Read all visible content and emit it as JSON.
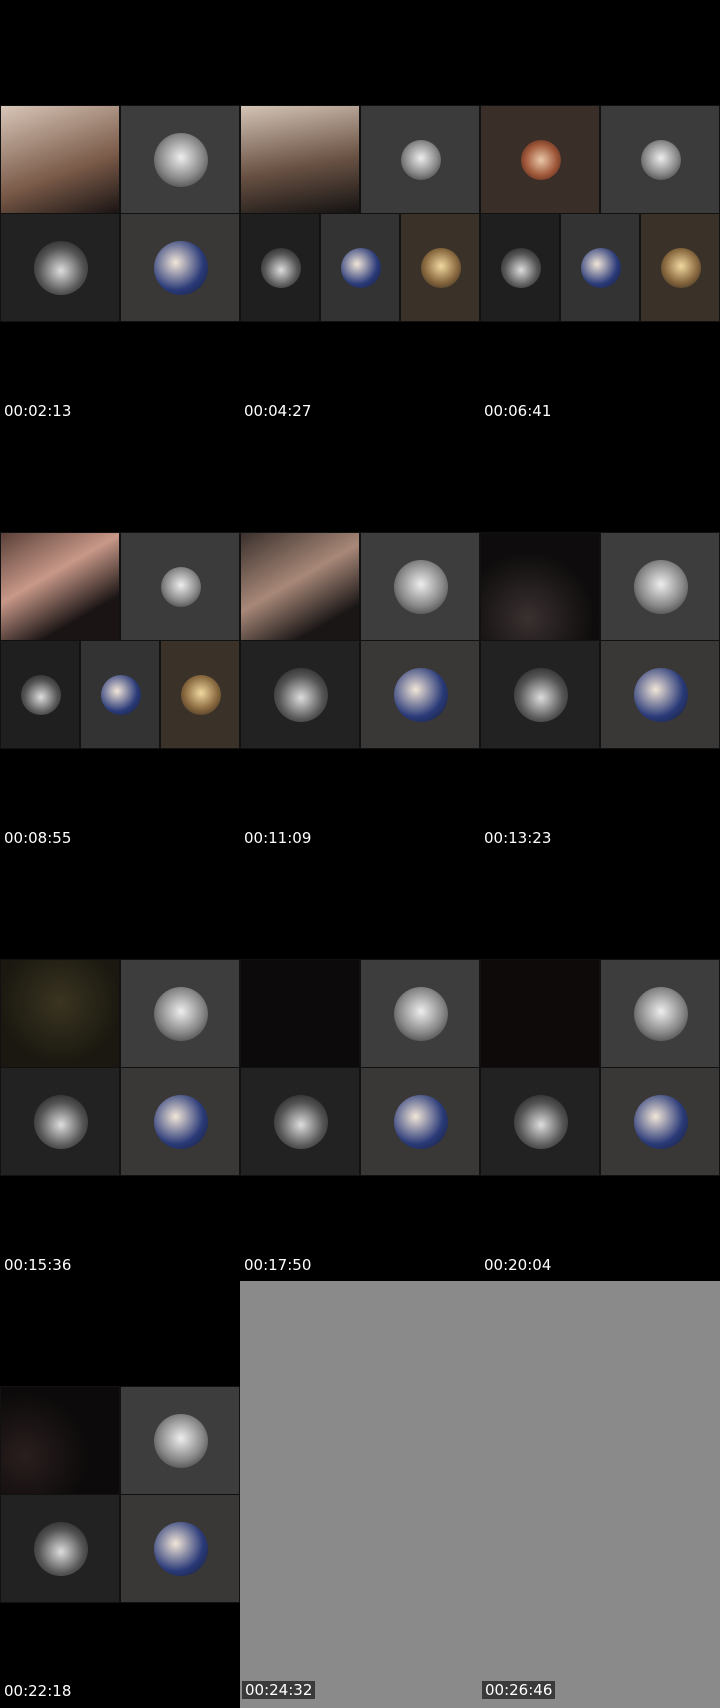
{
  "frames": [
    {
      "timestamp": "00:02:13"
    },
    {
      "timestamp": "00:04:27"
    },
    {
      "timestamp": "00:06:41"
    },
    {
      "timestamp": "00:08:55"
    },
    {
      "timestamp": "00:11:09"
    },
    {
      "timestamp": "00:13:23"
    },
    {
      "timestamp": "00:15:36"
    },
    {
      "timestamp": "00:17:50"
    },
    {
      "timestamp": "00:20:04"
    },
    {
      "timestamp": "00:22:18"
    },
    {
      "timestamp": "00:24:32"
    },
    {
      "timestamp": "00:26:46"
    }
  ]
}
